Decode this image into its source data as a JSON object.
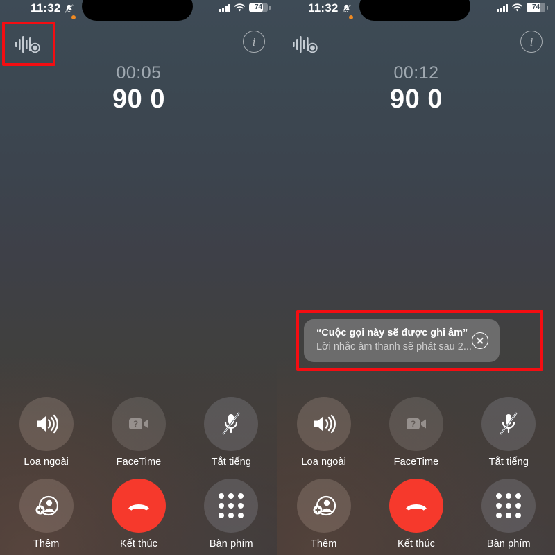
{
  "status_bar": {
    "time": "11:32",
    "bell_icon": "bell-muted-icon",
    "signal_icon": "cellular-signal-icon",
    "wifi_icon": "wifi-icon",
    "battery_percent": "74",
    "battery_level": 74,
    "island_dot_color": "#f08a22",
    "island_dot_name": "recording-indicator-dot"
  },
  "panels": [
    {
      "id": "left",
      "recording_icon": "call-recording-waveform-icon",
      "info_icon": "info-icon",
      "duration": "00:05",
      "number": "90 0",
      "toast_visible": false
    },
    {
      "id": "right",
      "recording_icon": "call-recording-waveform-icon",
      "info_icon": "info-icon",
      "duration": "00:12",
      "number": "90 0",
      "toast_visible": true
    }
  ],
  "toast": {
    "title": "“Cuộc gọi này sẽ được ghi âm”",
    "subtitle": "Lời nhắc âm thanh sẽ phát sau 2...",
    "close_icon": "close-circle-icon"
  },
  "controls": [
    {
      "label": "Loa ngoài",
      "icon": "speaker-icon",
      "style": "warm",
      "disabled": false
    },
    {
      "label": "FaceTime",
      "icon": "facetime-video-icon",
      "style": "dim",
      "disabled": true
    },
    {
      "label": "Tắt tiếng",
      "icon": "mic-muted-icon",
      "style": "cool",
      "disabled": false
    },
    {
      "label": "Thêm",
      "icon": "add-contact-icon",
      "style": "warm",
      "disabled": false
    },
    {
      "label": "Kết thúc",
      "icon": "end-call-icon",
      "style": "end",
      "disabled": false
    },
    {
      "label": "Bàn phím",
      "icon": "keypad-icon",
      "style": "cool",
      "disabled": false
    }
  ],
  "highlights": [
    {
      "name": "highlight-recording-icon",
      "color": "#f40d12"
    },
    {
      "name": "highlight-recording-toast",
      "color": "#f40d12"
    }
  ]
}
